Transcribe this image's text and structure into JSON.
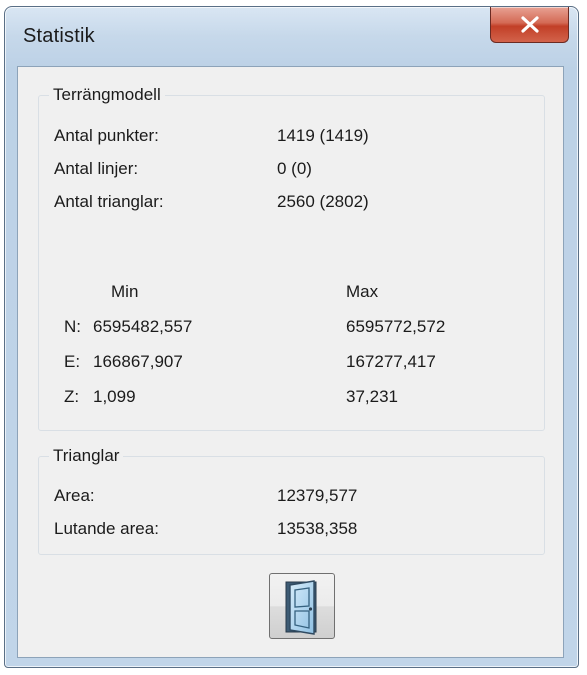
{
  "window": {
    "title": "Statistik",
    "close_icon": "close-x-icon"
  },
  "terrain": {
    "legend": "Terrängmodell",
    "rows": [
      {
        "label": "Antal punkter:",
        "value": "1419 (1419)"
      },
      {
        "label": "Antal linjer:",
        "value": "0 (0)"
      },
      {
        "label": "Antal trianglar:",
        "value": "2560 (2802)"
      }
    ],
    "min_header": "Min",
    "max_header": "Max",
    "coords": [
      {
        "axis": "N:",
        "min": "6595482,557",
        "max": "6595772,572"
      },
      {
        "axis": "E:",
        "min": "166867,907",
        "max": "167277,417"
      },
      {
        "axis": "Z:",
        "min": "1,099",
        "max": "37,231"
      }
    ]
  },
  "triangles": {
    "legend": "Trianglar",
    "rows": [
      {
        "label": "Area:",
        "value": "12379,577"
      },
      {
        "label": "Lutande area:",
        "value": "13538,358"
      }
    ]
  },
  "footer": {
    "exit_icon": "door-exit-icon"
  }
}
